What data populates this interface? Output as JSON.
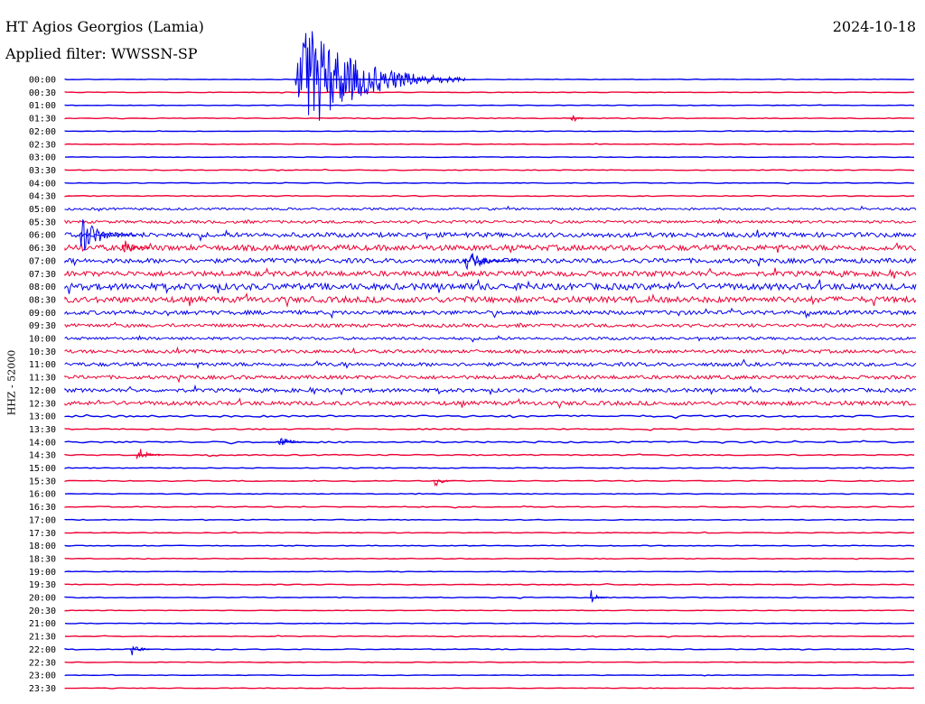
{
  "header": {
    "station": "HT Agios Georgios (Lamia)",
    "filter": "Applied filter: WWSSN-SP",
    "date": "2024-10-18"
  },
  "chart_data": {
    "type": "helicorder",
    "ylabel": "HHZ - 52000",
    "row_labels": [
      "00:00",
      "00:30",
      "01:00",
      "01:30",
      "02:00",
      "02:30",
      "03:00",
      "03:30",
      "04:00",
      "04:30",
      "05:00",
      "05:30",
      "06:00",
      "06:30",
      "07:00",
      "07:30",
      "08:00",
      "08:30",
      "09:00",
      "09:30",
      "10:00",
      "10:30",
      "11:00",
      "11:30",
      "12:00",
      "12:30",
      "13:00",
      "13:30",
      "14:00",
      "14:30",
      "15:00",
      "15:30",
      "16:00",
      "16:30",
      "17:00",
      "17:30",
      "18:00",
      "18:30",
      "19:00",
      "19:30",
      "20:00",
      "20:30",
      "21:00",
      "21:30",
      "22:00",
      "22:30",
      "23:00",
      "23:30"
    ],
    "trace_colors": [
      "#0000ee",
      "#ee0033"
    ],
    "noise_level": [
      0.3,
      0.3,
      0.3,
      0.4,
      0.3,
      0.3,
      0.3,
      0.4,
      0.4,
      0.5,
      1.2,
      1.5,
      2.5,
      3.0,
      2.5,
      2.8,
      3.5,
      3.2,
      2.2,
      1.8,
      1.5,
      1.8,
      2.0,
      2.0,
      2.0,
      2.2,
      1.0,
      0.6,
      0.8,
      0.6,
      0.4,
      0.5,
      0.4,
      0.5,
      0.4,
      0.4,
      0.4,
      0.4,
      0.3,
      0.4,
      0.4,
      0.3,
      0.3,
      0.4,
      0.4,
      0.3,
      0.3,
      0.3
    ],
    "events": [
      {
        "row": 0,
        "start_min": 8.1,
        "duration_min": 6,
        "amplitude": 9
      },
      {
        "row": 12,
        "start_min": 0.5,
        "duration_min": 2,
        "amplitude": 3
      },
      {
        "row": 13,
        "start_min": 2,
        "duration_min": 1,
        "amplitude": 2
      },
      {
        "row": 14,
        "start_min": 14,
        "duration_min": 2,
        "amplitude": 2
      },
      {
        "row": 28,
        "start_min": 7.5,
        "duration_min": 1,
        "amplitude": 1.2
      },
      {
        "row": 29,
        "start_min": 2.5,
        "duration_min": 1,
        "amplitude": 1.5
      },
      {
        "row": 31,
        "start_min": 13,
        "duration_min": 0.7,
        "amplitude": 1
      },
      {
        "row": 40,
        "start_min": 18.5,
        "duration_min": 0.6,
        "amplitude": 1.2
      },
      {
        "row": 44,
        "start_min": 2.3,
        "duration_min": 0.7,
        "amplitude": 1.5
      },
      {
        "row": 3,
        "start_min": 17.8,
        "duration_min": 0.5,
        "amplitude": 1.2
      }
    ]
  }
}
